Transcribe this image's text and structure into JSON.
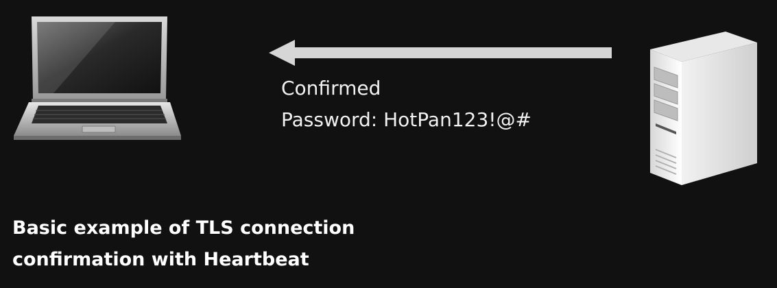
{
  "diagram": {
    "client": {
      "icon": "laptop-icon"
    },
    "server": {
      "icon": "server-icon"
    },
    "arrow": {
      "direction": "server-to-client",
      "color": "#d6d6d6"
    },
    "response_lines": [
      "Confirmed",
      "Password: HotPan123!@#"
    ],
    "caption_lines": [
      "Basic example of TLS connection",
      "confirmation with Heartbeat"
    ]
  },
  "colors": {
    "background": "#111111",
    "text": "#ffffff",
    "arrow": "#d6d6d6"
  }
}
